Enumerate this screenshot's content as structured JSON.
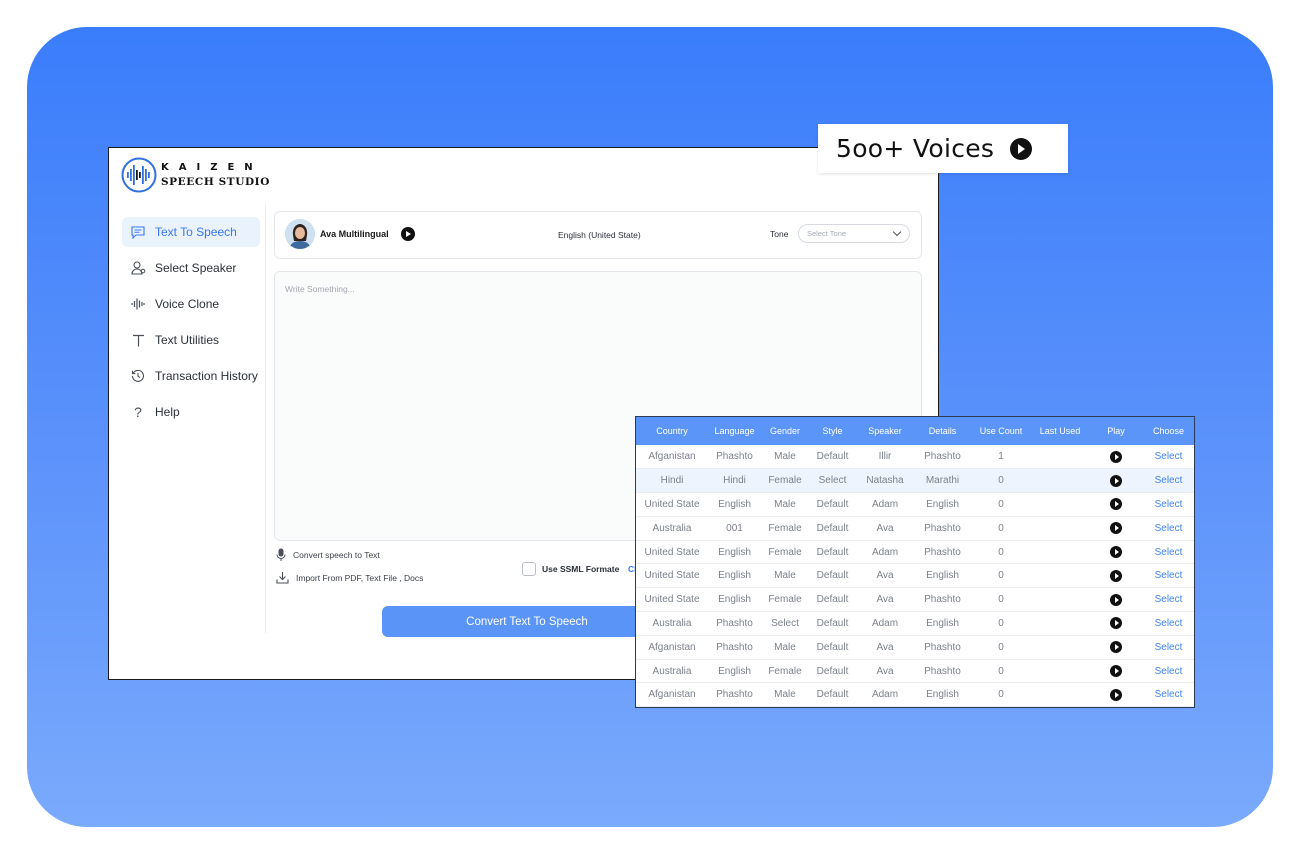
{
  "brand": {
    "logo_top": "KAIZEN",
    "logo_bottom": "SPEECH STUDIO"
  },
  "sidebar": {
    "items": [
      {
        "label": "Text To Speech",
        "icon": "chat-icon",
        "active": true
      },
      {
        "label": "Select Speaker",
        "icon": "user-icon",
        "active": false
      },
      {
        "label": "Voice Clone",
        "icon": "waveform-icon",
        "active": false
      },
      {
        "label": "Text Utilities",
        "icon": "text-icon",
        "active": false
      },
      {
        "label": "Transaction History",
        "icon": "history-icon",
        "active": false
      },
      {
        "label": "Help",
        "icon": "question-icon",
        "active": false
      }
    ]
  },
  "voice_bar": {
    "voice_name": "Ava Multilingual",
    "language": "English (United State)",
    "tone_label": "Tone",
    "tone_placeholder": "Select Tone"
  },
  "editor": {
    "placeholder": "Write Something..."
  },
  "tools": {
    "speech_to_text": "Convert speech to Text",
    "import": "Import From PDF, Text File , Docs",
    "ssml_label": "Use SSML Formate",
    "ssml_link": "Click here",
    "convert_button": "Convert Text To Speech"
  },
  "badge": {
    "text": "5oo+ Voices"
  },
  "voices_table": {
    "columns": [
      "Country",
      "Language",
      "Gender",
      "Style",
      "Speaker",
      "Details",
      "Use Count",
      "Last Used",
      "Play",
      "Choose"
    ],
    "rows": [
      [
        "Afganistan",
        "Phashto",
        "Male",
        "Default",
        "Illir",
        "Phashto",
        "1",
        "",
        "",
        "Select"
      ],
      [
        "Hindi",
        "Hindi",
        "Female",
        "Select",
        "Natasha",
        "Marathi",
        "0",
        "",
        "",
        "Select"
      ],
      [
        "United State",
        "English",
        "Male",
        "Default",
        "Adam",
        "English",
        "0",
        "",
        "",
        "Select"
      ],
      [
        "Australia",
        "001",
        "Female",
        "Default",
        "Ava",
        "Phashto",
        "0",
        "",
        "",
        "Select"
      ],
      [
        "United State",
        "English",
        "Female",
        "Default",
        "Adam",
        "Phashto",
        "0",
        "",
        "",
        "Select"
      ],
      [
        "United State",
        "English",
        "Male",
        "Default",
        "Ava",
        "English",
        "0",
        "",
        "",
        "Select"
      ],
      [
        "United State",
        "English",
        "Female",
        "Default",
        "Ava",
        "Phashto",
        "0",
        "",
        "",
        "Select"
      ],
      [
        "Australia",
        "Phashto",
        "Select",
        "Default",
        "Adam",
        "English",
        "0",
        "",
        "",
        "Select"
      ],
      [
        "Afganistan",
        "Phashto",
        "Male",
        "Default",
        "Ava",
        "Phashto",
        "0",
        "",
        "",
        "Select"
      ],
      [
        "Australia",
        "English",
        "Female",
        "Default",
        "Ava",
        "Phashto",
        "0",
        "",
        "",
        "Select"
      ],
      [
        "Afganistan",
        "Phashto",
        "Male",
        "Default",
        "Adam",
        "English",
        "0",
        "",
        "",
        "Select"
      ]
    ],
    "highlighted_row": 1
  },
  "colors": {
    "background_gradient_top": "#3a7dfb",
    "background_gradient_bottom": "#7aaafc",
    "accent": "#3778f4",
    "button": "#5a94f6",
    "table_header": "#5b95f7"
  }
}
